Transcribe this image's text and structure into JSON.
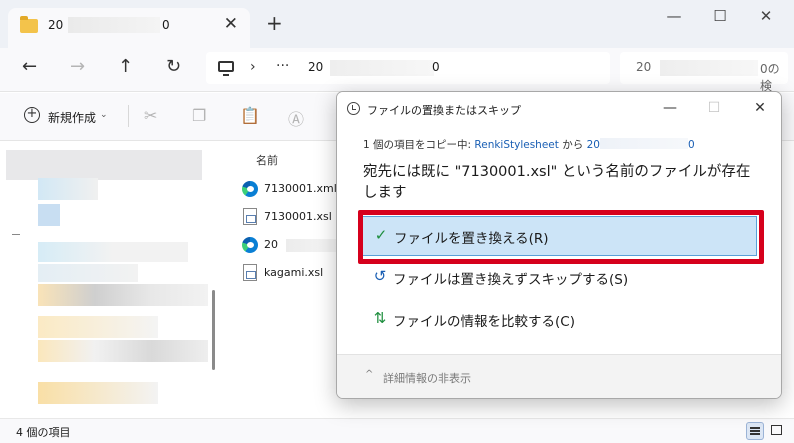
{
  "explorer": {
    "tab": {
      "title_prefix": "20",
      "title_suffix": "0",
      "close_glyph": "✕"
    },
    "new_tab_glyph": "+",
    "window_buttons": {
      "minimize": "—",
      "maximize": "☐",
      "close": "✕"
    },
    "nav": {
      "back": "←",
      "forward": "→",
      "up": "↑",
      "refresh": "↻"
    },
    "address": {
      "chevron": "›",
      "ellipsis": "···",
      "path_prefix": "20",
      "path_suffix": "0"
    },
    "search": {
      "placeholder_prefix": "20",
      "placeholder_suffix": "0の検"
    },
    "toolbar": {
      "new_label": "新規作成",
      "new_caret": "⌄"
    },
    "column_header": "名前",
    "files": [
      {
        "name": "7130001.xml",
        "icon": "edge-icon"
      },
      {
        "name": "7130001.xsl",
        "icon": "xsl-file-icon"
      },
      {
        "name": "20",
        "icon": "edge-icon"
      },
      {
        "name": "kagami.xsl",
        "icon": "xsl-file-icon"
      }
    ],
    "status": "4 個の項目"
  },
  "dialog": {
    "title": "ファイルの置換またはスキップ",
    "buttons": {
      "minimize": "—",
      "maximize": "☐",
      "close": "✕"
    },
    "copying_prefix": "1 個の項目をコピー中: ",
    "source": "RenkiStylesheet",
    "from_word": " から ",
    "dest_prefix": "20",
    "dest_suffix": "0",
    "message": "宛先には既に \"7130001.xsl\" という名前のファイルが存在します",
    "options": [
      {
        "label": "ファイルを置き換える(R)",
        "icon": "✓"
      },
      {
        "label": "ファイルは置き換えずスキップする(S)",
        "icon": "↺"
      },
      {
        "label": "ファイルの情報を比較する(C)",
        "icon": "⇅"
      }
    ],
    "footer": {
      "caret": "^",
      "label": "詳細情報の非表示"
    }
  },
  "colors": {
    "accent": "#0067c0",
    "selected_option": "#cce4f7",
    "highlight_border": "#d6001c",
    "check_green": "#1e8e3e"
  }
}
